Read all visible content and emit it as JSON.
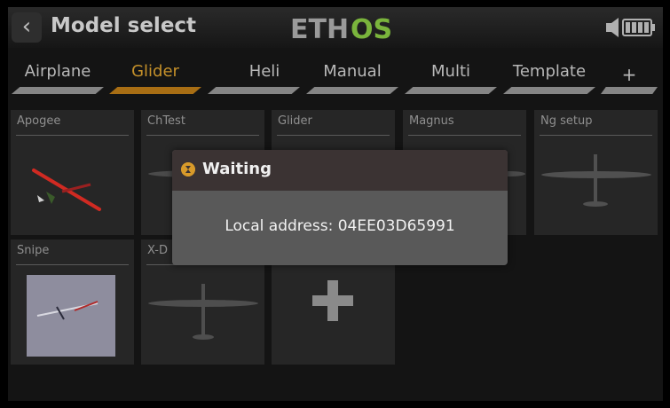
{
  "header": {
    "title": "Model select",
    "logo_text": "ETHOS"
  },
  "tabs": [
    {
      "label": "Airplane",
      "active": false
    },
    {
      "label": "Glider",
      "active": true
    },
    {
      "label": "Heli",
      "active": false
    },
    {
      "label": "Manual",
      "active": false
    },
    {
      "label": "Multi",
      "active": false
    },
    {
      "label": "Template",
      "active": false
    },
    {
      "label": "+",
      "active": false
    }
  ],
  "models": [
    {
      "name": "Apogee"
    },
    {
      "name": "ChTest"
    },
    {
      "name": "Glider"
    },
    {
      "name": "Magnus"
    },
    {
      "name": "Ng setup"
    },
    {
      "name": "Snipe"
    },
    {
      "name": "X-D"
    }
  ],
  "dialog": {
    "title": "Waiting",
    "message": "Local address: 04EE03D65991"
  },
  "colors": {
    "accent": "#a86e14",
    "logo_green": "#7ab43c",
    "background": "#141414",
    "card": "#262626"
  }
}
